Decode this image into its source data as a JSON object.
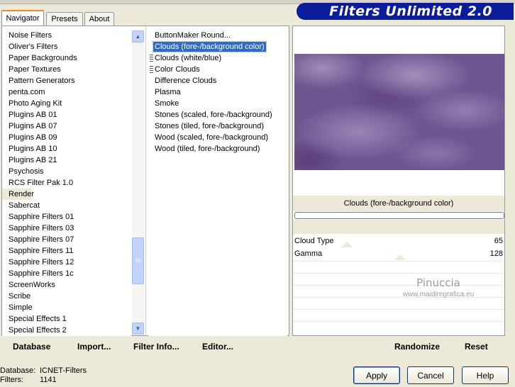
{
  "tabs": [
    "Navigator",
    "Presets",
    "About"
  ],
  "banner_title": "Filters Unlimited 2.0",
  "categories": [
    "Noise Filters",
    "Oliver's Filters",
    "Paper Backgrounds",
    "Paper Textures",
    "Pattern Generators",
    "penta.com",
    "Photo Aging Kit",
    "Plugins AB 01",
    "Plugins AB 07",
    "Plugins AB 09",
    "Plugins AB 10",
    "Plugins AB 21",
    "Psychosis",
    "RCS Filter Pak 1.0",
    "Render",
    "Sabercat",
    "Sapphire Filters 01",
    "Sapphire Filters 03",
    "Sapphire Filters 07",
    "Sapphire Filters 11",
    "Sapphire Filters 12",
    "Sapphire Filters 1c",
    "ScreenWorks",
    "Scribe",
    "Simple",
    "Special Effects 1",
    "Special Effects 2"
  ],
  "highlighted_category": "Render",
  "effects": [
    "ButtonMaker Round...",
    "Clouds (fore-/background color)",
    "Clouds (white/blue)",
    "Color Clouds",
    "Difference Clouds",
    "Plasma",
    "Smoke",
    "Stones (scaled, fore-/background)",
    "Stones (tiled, fore-/background)",
    "Wood (scaled, fore-/background)",
    "Wood (tiled, fore-/background)"
  ],
  "selected_effect": "Clouds (fore-/background color)",
  "effect_name": "Clouds (fore-/background color)",
  "params": [
    {
      "label": "Cloud Type",
      "value": "65"
    },
    {
      "label": "Gamma",
      "value": "128"
    }
  ],
  "watermark": {
    "line1": "Pinuccia",
    "line2": "www.maidiregrafica.eu"
  },
  "left_buttons": {
    "database": "Database",
    "import": "Import...",
    "filter_info": "Filter Info...",
    "editor": "Editor..."
  },
  "right_buttons": {
    "randomize": "Randomize",
    "reset": "Reset"
  },
  "status": {
    "database_label": "Database:",
    "database_value": "ICNET-Filters",
    "filters_label": "Filters:",
    "filters_value": "1141"
  },
  "dialog_buttons": {
    "apply": "Apply",
    "cancel": "Cancel",
    "help": "Help"
  },
  "colors": {
    "selection": "#316ac5",
    "banner": "#0b1d9a",
    "preview_base": "#6e5590"
  }
}
